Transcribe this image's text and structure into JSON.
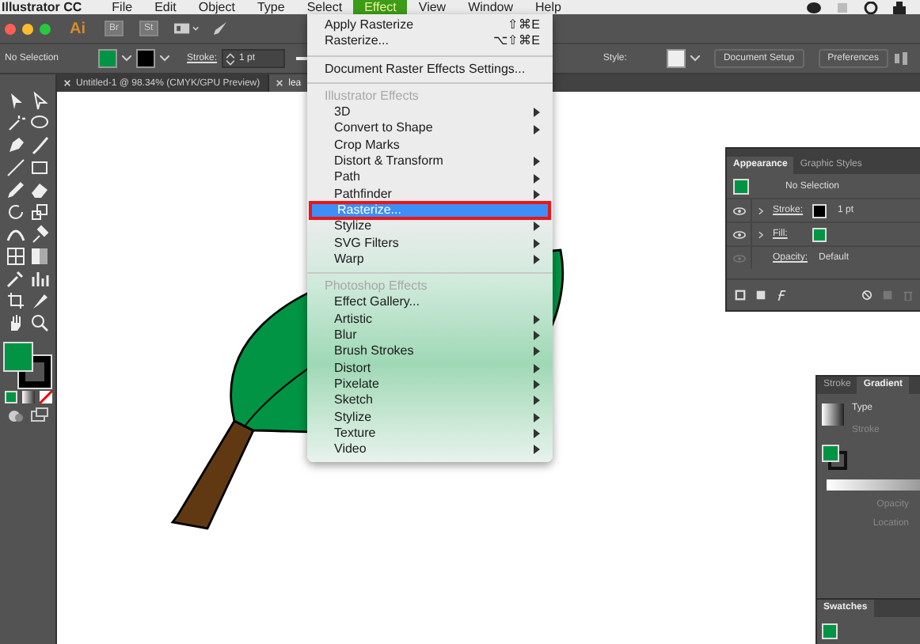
{
  "menubar": {
    "app": "Illustrator CC",
    "items": [
      {
        "label": "File",
        "selected": false
      },
      {
        "label": "Edit",
        "selected": false
      },
      {
        "label": "Object",
        "selected": false
      },
      {
        "label": "Type",
        "selected": false
      },
      {
        "label": "Select",
        "selected": false
      },
      {
        "label": "Effect",
        "selected": true
      },
      {
        "label": "View",
        "selected": false
      },
      {
        "label": "Window",
        "selected": false
      },
      {
        "label": "Help",
        "selected": false
      }
    ]
  },
  "appbar": {
    "logo": "Ai",
    "buttons": [
      "Br",
      "St"
    ]
  },
  "control_bar": {
    "selection": "No Selection",
    "stroke_label": "Stroke:",
    "stroke_value": "1 pt",
    "style_label": "Style:",
    "buttons": [
      "Document Setup",
      "Preferences"
    ]
  },
  "tabs": [
    {
      "label": "Untitled-1 @ 98.34% (CMYK/GPU Preview)",
      "selected": false
    },
    {
      "label": "lea",
      "selected": true
    }
  ],
  "effect_menu": [
    {
      "kind": "item",
      "label": "Apply Rasterize",
      "shortcut": "⇧⌘E",
      "submenu": false,
      "selected": false,
      "outlined": false
    },
    {
      "kind": "item",
      "label": "Rasterize...",
      "shortcut": "⌥⇧⌘E",
      "submenu": false,
      "selected": false,
      "outlined": false
    },
    {
      "kind": "separator"
    },
    {
      "kind": "item",
      "label": "Document Raster Effects Settings...",
      "submenu": false,
      "selected": false,
      "outlined": false
    },
    {
      "kind": "separator"
    },
    {
      "kind": "header",
      "label": "Illustrator Effects"
    },
    {
      "kind": "item",
      "label": "3D",
      "submenu": true,
      "selected": false,
      "outlined": false
    },
    {
      "kind": "item",
      "label": "Convert to Shape",
      "submenu": true,
      "selected": false,
      "outlined": false
    },
    {
      "kind": "item",
      "label": "Crop Marks",
      "submenu": false,
      "selected": false,
      "outlined": false
    },
    {
      "kind": "item",
      "label": "Distort & Transform",
      "submenu": true,
      "selected": false,
      "outlined": false
    },
    {
      "kind": "item",
      "label": "Path",
      "submenu": true,
      "selected": false,
      "outlined": false
    },
    {
      "kind": "item",
      "label": "Pathfinder",
      "submenu": true,
      "selected": false,
      "outlined": false
    },
    {
      "kind": "item",
      "label": "Rasterize...",
      "submenu": false,
      "selected": true,
      "outlined": true
    },
    {
      "kind": "item",
      "label": "Stylize",
      "submenu": true,
      "selected": false,
      "outlined": false
    },
    {
      "kind": "item",
      "label": "SVG Filters",
      "submenu": true,
      "selected": false,
      "outlined": false
    },
    {
      "kind": "item",
      "label": "Warp",
      "submenu": true,
      "selected": false,
      "outlined": false
    },
    {
      "kind": "separator"
    },
    {
      "kind": "header",
      "label": "Photoshop Effects"
    },
    {
      "kind": "item",
      "label": "Effect Gallery...",
      "submenu": false,
      "selected": false,
      "outlined": false
    },
    {
      "kind": "item",
      "label": "Artistic",
      "submenu": true,
      "selected": false,
      "outlined": false
    },
    {
      "kind": "item",
      "label": "Blur",
      "submenu": true,
      "selected": false,
      "outlined": false
    },
    {
      "kind": "item",
      "label": "Brush Strokes",
      "submenu": true,
      "selected": false,
      "outlined": false
    },
    {
      "kind": "item",
      "label": "Distort",
      "submenu": true,
      "selected": false,
      "outlined": false
    },
    {
      "kind": "item",
      "label": "Pixelate",
      "submenu": true,
      "selected": false,
      "outlined": false
    },
    {
      "kind": "item",
      "label": "Sketch",
      "submenu": true,
      "selected": false,
      "outlined": false
    },
    {
      "kind": "item",
      "label": "Stylize",
      "submenu": true,
      "selected": false,
      "outlined": false
    },
    {
      "kind": "item",
      "label": "Texture",
      "submenu": true,
      "selected": false,
      "outlined": false
    },
    {
      "kind": "item",
      "label": "Video",
      "submenu": true,
      "selected": false,
      "outlined": false
    }
  ],
  "appearance_panel": {
    "tabs": [
      {
        "label": "Appearance",
        "selected": true
      },
      {
        "label": "Graphic Styles",
        "selected": false
      }
    ],
    "title": "No Selection",
    "rows": [
      {
        "label": "Stroke:",
        "kind": "stroke",
        "value": "1 pt",
        "expandable": true,
        "visible": true
      },
      {
        "label": "Fill:",
        "kind": "fill",
        "expandable": true,
        "visible": true
      },
      {
        "label": "Opacity:",
        "kind": "opacity",
        "value": "Default",
        "expandable": false,
        "visible": false
      }
    ]
  },
  "gradient_panel": {
    "tabs": [
      {
        "label": "Stroke",
        "selected": false
      },
      {
        "label": "Gradient",
        "selected": true
      }
    ],
    "labels": [
      "Type",
      "Stroke",
      "Opacity",
      "Location"
    ]
  },
  "swatches_panel": {
    "tabs": [
      {
        "label": "Swatches",
        "selected": true
      }
    ]
  }
}
